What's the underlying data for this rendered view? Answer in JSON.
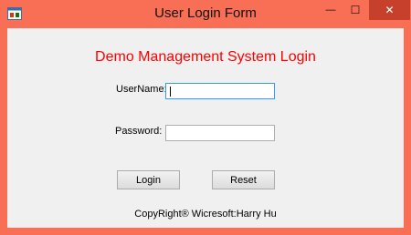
{
  "window": {
    "title": "User Login Form",
    "controls": {
      "minimize": "—",
      "maximize": "☐",
      "close": "✕"
    }
  },
  "form": {
    "heading": "Demo Management System Login",
    "username_label": "UserName:",
    "username_value": "",
    "password_label": "Password:",
    "password_value": "",
    "login_label": "Login",
    "reset_label": "Reset",
    "footer": "CopyRight® Wicresoft:Harry Hu"
  },
  "colors": {
    "titlebar": "#f86f55",
    "heading": "#ff0000",
    "client_bg": "#f0f0f0"
  }
}
